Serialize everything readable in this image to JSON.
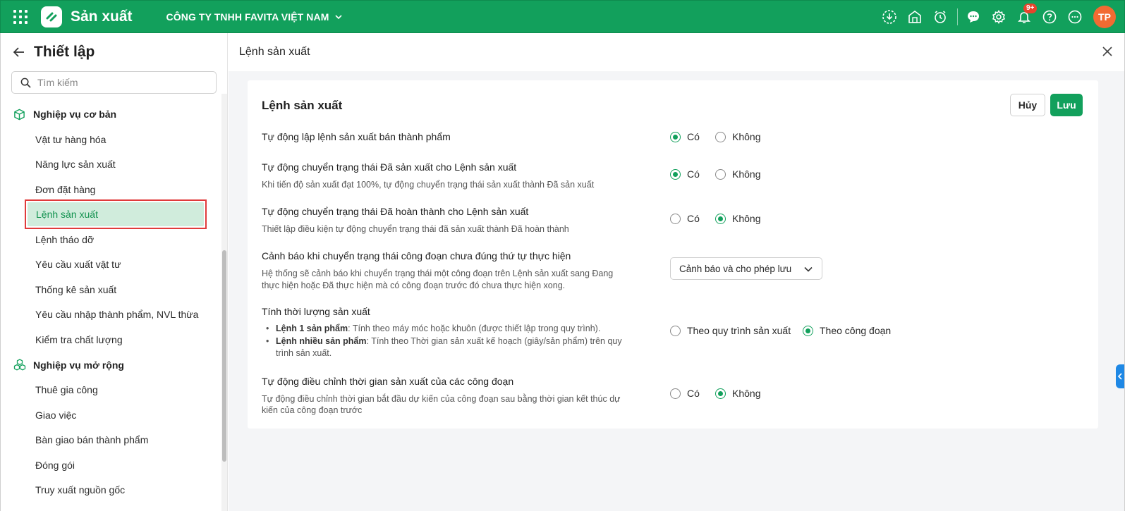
{
  "header": {
    "app_title": "Sản xuất",
    "company": "CÔNG TY TNHH FAVITA VIỆT NAM",
    "notification_badge": "9+",
    "avatar_initials": "TP",
    "brand_color": "#12a05c"
  },
  "sidebar": {
    "title": "Thiết lập",
    "search_placeholder": "Tìm kiếm",
    "groups": [
      {
        "label": "Nghiệp vụ cơ bản",
        "icon": "cube-icon",
        "items": [
          "Vật tư hàng hóa",
          "Năng lực sản xuất",
          "Đơn đặt hàng",
          "Lệnh sản xuất",
          "Lệnh tháo dỡ",
          "Yêu cầu xuất vật tư",
          "Thống kê sản xuất",
          "Yêu cầu nhập thành phẩm, NVL thừa",
          "Kiểm tra chất lượng"
        ]
      },
      {
        "label": "Nghiệp vụ mở rộng",
        "icon": "cubes-icon",
        "items": [
          "Thuê gia công",
          "Giao việc",
          "Bàn giao bán thành phẩm",
          "Đóng gói",
          "Truy xuất nguồn gốc"
        ]
      }
    ],
    "active_item": "Lệnh sản xuất"
  },
  "main": {
    "header_title": "Lệnh sản xuất",
    "card_title": "Lệnh sản xuất",
    "cancel_label": "Hủy",
    "save_label": "Lưu",
    "settings": [
      {
        "title": "Tự động lập lệnh sản xuất bán thành phẩm",
        "options": [
          "Có",
          "Không"
        ],
        "selected": "Có"
      },
      {
        "title": "Tự động chuyển trạng thái Đã sản xuất cho Lệnh sản xuất",
        "description": "Khi tiến độ sản xuất đạt 100%, tự động chuyển trạng thái sản xuất thành Đã sản xuất",
        "options": [
          "Có",
          "Không"
        ],
        "selected": "Có"
      },
      {
        "title": "Tự động chuyển trạng thái Đã hoàn thành cho Lệnh sản xuất",
        "description": "Thiết lập điều kiện tự động chuyển trạng thái đã sản xuất thành Đã hoàn thành",
        "options": [
          "Có",
          "Không"
        ],
        "selected": "Không"
      },
      {
        "title": "Cảnh báo khi chuyển trạng thái công đoạn chưa đúng thứ tự thực hiện",
        "description_line1": "Hệ thống sẽ cảnh báo khi chuyển trạng thái một công đoạn trên Lệnh sản xuất sang Đang",
        "description_line2": "thực hiện hoặc Đã thực hiện mà có công đoạn trước đó chưa thực hiện xong.",
        "select_value": "Cảnh báo và cho phép lưu"
      },
      {
        "title": "Tính thời lượng sản xuất",
        "bullet1_bold": "Lệnh 1 sản phẩm",
        "bullet1_text": ": Tính theo máy móc hoặc khuôn (được thiết lập trong quy trình).",
        "bullet2_bold": "Lệnh nhiều sản phẩm",
        "bullet2_text": ": Tính theo Thời gian sản xuất kế hoạch (giây/sản phẩm) trên quy",
        "bullet2_text2": "trình sản xuất.",
        "options": [
          "Theo quy trình sản xuất",
          "Theo công đoạn"
        ],
        "selected": "Theo công đoạn"
      },
      {
        "title": "Tự động điều chỉnh thời gian sản xuất của các công đoạn",
        "description_line1": "Tự động điều chỉnh thời gian bắt đầu dự kiến của công đoạn sau bằng thời gian kết thúc dự",
        "description_line2": "kiến của công đoạn trước",
        "options": [
          "Có",
          "Không"
        ],
        "selected": "Không"
      }
    ]
  }
}
